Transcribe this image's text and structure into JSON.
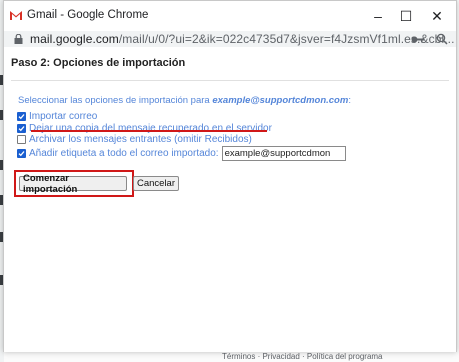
{
  "window": {
    "title": "Gmail - Google Chrome",
    "minimize": "–",
    "maximize": "☐",
    "close": "✕"
  },
  "address_bar": {
    "url_domain": "mail.google.com",
    "url_rest": "/mail/u/0/?ui=2&ik=022c4735d7&jsver=f4JzsmVf1ml.es.&cbl..."
  },
  "dialog": {
    "step_title": "Paso 2: Opciones de importación",
    "select_prefix": "Seleccionar las opciones de importación para ",
    "select_email": "example@supportcdmon.com",
    "select_suffix": ":",
    "options": [
      {
        "label": "Importar correo",
        "checked": true
      },
      {
        "label": "Dejar una copia del mensaje recuperado en el servidor",
        "checked": true
      },
      {
        "label": "Archivar los mensajes entrantes (omitir Recibidos)",
        "checked": false
      },
      {
        "label": "Añadir etiqueta a todo el correo importado:",
        "checked": true
      }
    ],
    "label_value": "example@supportcdmon",
    "start_button": "Comenzar importación",
    "cancel_button": "Cancelar"
  },
  "background_footer": "Términos · Privacidad · Política del programa",
  "colors": {
    "highlight": "#d01818",
    "option_text": "#5586d9",
    "checkbox": "#1a5fd0"
  }
}
